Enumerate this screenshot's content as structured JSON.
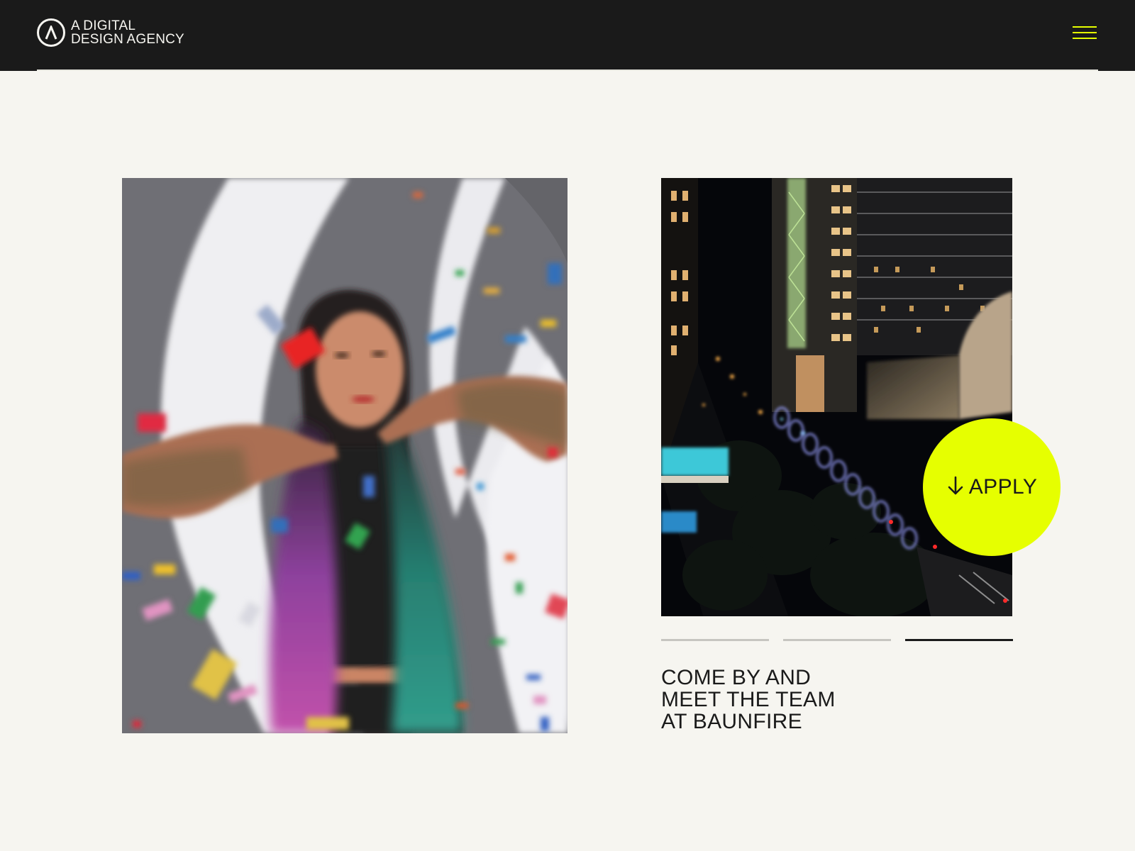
{
  "header": {
    "logo_line1": "A DIGITAL",
    "logo_line2": "DESIGN AGENCY",
    "logo_icon": "chevron-circle-logo",
    "menu_icon": "hamburger-menu-icon"
  },
  "gallery": {
    "left_photo": "woman-confetti-photo",
    "right_photo": "city-night-aerial-photo"
  },
  "slider": {
    "total": 3,
    "active_index": 3
  },
  "caption": {
    "line1": "COME BY AND",
    "line2": "MEET THE TEAM",
    "line3": "AT BAUNFIRE"
  },
  "cta": {
    "label": "APPLY",
    "icon": "arrow-down-icon"
  },
  "colors": {
    "accent": "#e6ff00",
    "header_bg": "#1a1a1a",
    "page_bg": "#f6f5f0",
    "text": "#1a1a1a"
  }
}
